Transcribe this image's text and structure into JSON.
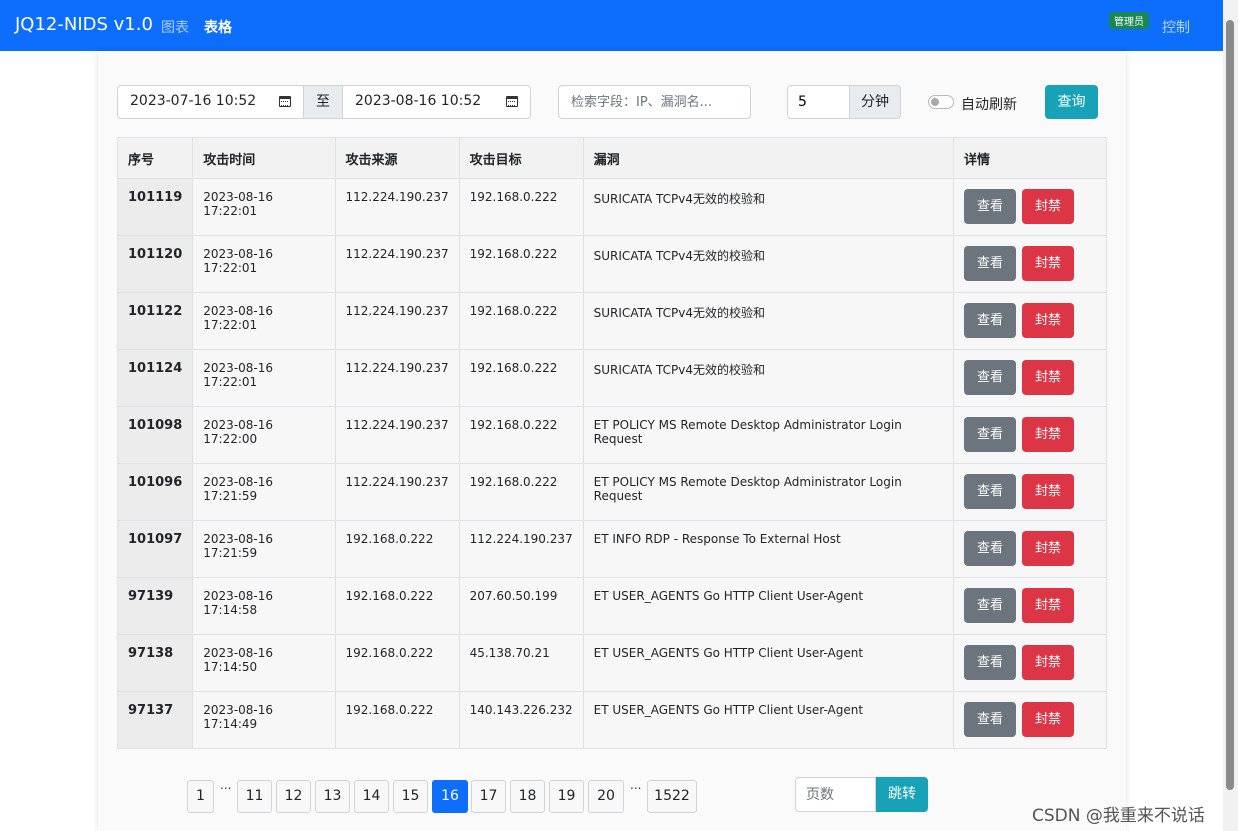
{
  "navbar": {
    "brand": "JQ12-NIDS v1.0",
    "links": [
      "图表",
      "表格"
    ],
    "admin_badge": "管理员",
    "control": "控制"
  },
  "filters": {
    "start_date": "2023-07-16 10:52",
    "to_label": "至",
    "end_date": "2023-08-16 10:52",
    "search_placeholder": "检索字段：IP、漏洞名...",
    "minutes_value": "5",
    "minutes_unit": "分钟",
    "auto_refresh_label": "自动刷新",
    "query_label": "查询"
  },
  "table": {
    "headers": [
      "序号",
      "攻击时间",
      "攻击来源",
      "攻击目标",
      "漏洞",
      "详情"
    ],
    "view_label": "查看",
    "ban_label": "封禁",
    "rows": [
      {
        "id": "101119",
        "time": "2023-08-16 17:22:01",
        "src": "112.224.190.237",
        "dst": "192.168.0.222",
        "vuln": "SURICATA TCPv4无效的校验和"
      },
      {
        "id": "101120",
        "time": "2023-08-16 17:22:01",
        "src": "112.224.190.237",
        "dst": "192.168.0.222",
        "vuln": "SURICATA TCPv4无效的校验和"
      },
      {
        "id": "101122",
        "time": "2023-08-16 17:22:01",
        "src": "112.224.190.237",
        "dst": "192.168.0.222",
        "vuln": "SURICATA TCPv4无效的校验和"
      },
      {
        "id": "101124",
        "time": "2023-08-16 17:22:01",
        "src": "112.224.190.237",
        "dst": "192.168.0.222",
        "vuln": "SURICATA TCPv4无效的校验和"
      },
      {
        "id": "101098",
        "time": "2023-08-16 17:22:00",
        "src": "112.224.190.237",
        "dst": "192.168.0.222",
        "vuln": "ET POLICY MS Remote Desktop Administrator Login Request"
      },
      {
        "id": "101096",
        "time": "2023-08-16 17:21:59",
        "src": "112.224.190.237",
        "dst": "192.168.0.222",
        "vuln": "ET POLICY MS Remote Desktop Administrator Login Request"
      },
      {
        "id": "101097",
        "time": "2023-08-16 17:21:59",
        "src": "192.168.0.222",
        "dst": "112.224.190.237",
        "vuln": "ET INFO RDP - Response To External Host"
      },
      {
        "id": "97139",
        "time": "2023-08-16 17:14:58",
        "src": "192.168.0.222",
        "dst": "207.60.50.199",
        "vuln": "ET USER_AGENTS Go HTTP Client User-Agent"
      },
      {
        "id": "97138",
        "time": "2023-08-16 17:14:50",
        "src": "192.168.0.222",
        "dst": "45.138.70.21",
        "vuln": "ET USER_AGENTS Go HTTP Client User-Agent"
      },
      {
        "id": "97137",
        "time": "2023-08-16 17:14:49",
        "src": "192.168.0.222",
        "dst": "140.143.226.232",
        "vuln": "ET USER_AGENTS Go HTTP Client User-Agent"
      }
    ]
  },
  "pagination": {
    "pages": [
      "1",
      "11",
      "12",
      "13",
      "14",
      "15",
      "16",
      "17",
      "18",
      "19",
      "20",
      "1522"
    ],
    "active_page": "16",
    "ellipsis": "...",
    "page_placeholder": "页数",
    "jump_label": "跳转"
  },
  "watermark": "CSDN @我重来不说话",
  "colors": {
    "navbar": "#0d6efd",
    "query": "#17a2b8",
    "view": "#6c757d",
    "ban": "#dc3545",
    "active_page": "#0d6efd",
    "badge": "#198754"
  }
}
